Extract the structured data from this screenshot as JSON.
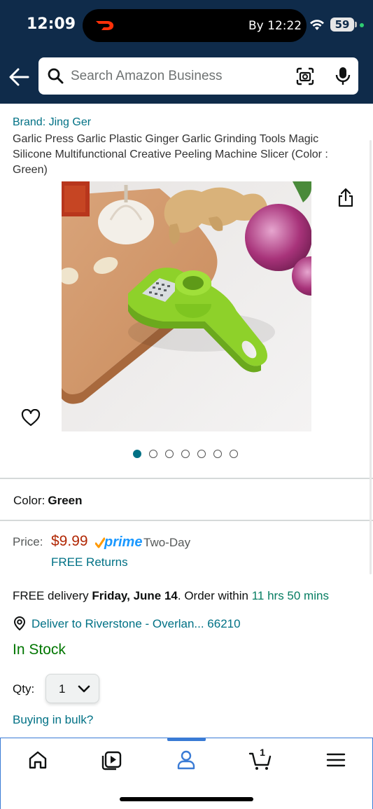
{
  "status_bar": {
    "time": "12:09",
    "delivery_eta": "By 12:22",
    "battery": "59"
  },
  "search": {
    "placeholder": "Search Amazon Business"
  },
  "product": {
    "brand": "Brand: Jing Ger",
    "title": "Garlic Press Garlic Plastic Ginger Garlic Grinding Tools Magic Silicone Multifunctional Creative Peeling Machine Slicer (Color : Green)",
    "image_count": 7,
    "active_image_index": 0
  },
  "color": {
    "label": "Color:",
    "value": "Green"
  },
  "price": {
    "label": "Price:",
    "value": "$9.99",
    "prime": "prime",
    "shipping": "Two-Day",
    "returns": "FREE Returns"
  },
  "delivery": {
    "prefix": "FREE delivery ",
    "date": "Friday, June 14",
    "middle": ". Order within ",
    "countdown": "11 hrs 50 mins",
    "location": "Deliver to Riverstone - Overlan... 66210"
  },
  "stock": {
    "status": "In Stock"
  },
  "quantity": {
    "label": "Qty:",
    "value": "1"
  },
  "bulk": {
    "link": "Buying in bulk?"
  },
  "bottom_nav": {
    "items": [
      "home-icon",
      "video-icon",
      "account-icon",
      "cart-icon",
      "menu-icon"
    ],
    "active": "account-icon",
    "cart_count": "1"
  },
  "colors": {
    "header_bg": "#0f2b4a",
    "link": "#007185",
    "price": "#b12704",
    "in_stock": "#007600",
    "prime_blue": "#1a98ff",
    "active_nav": "#3a7bd5"
  }
}
